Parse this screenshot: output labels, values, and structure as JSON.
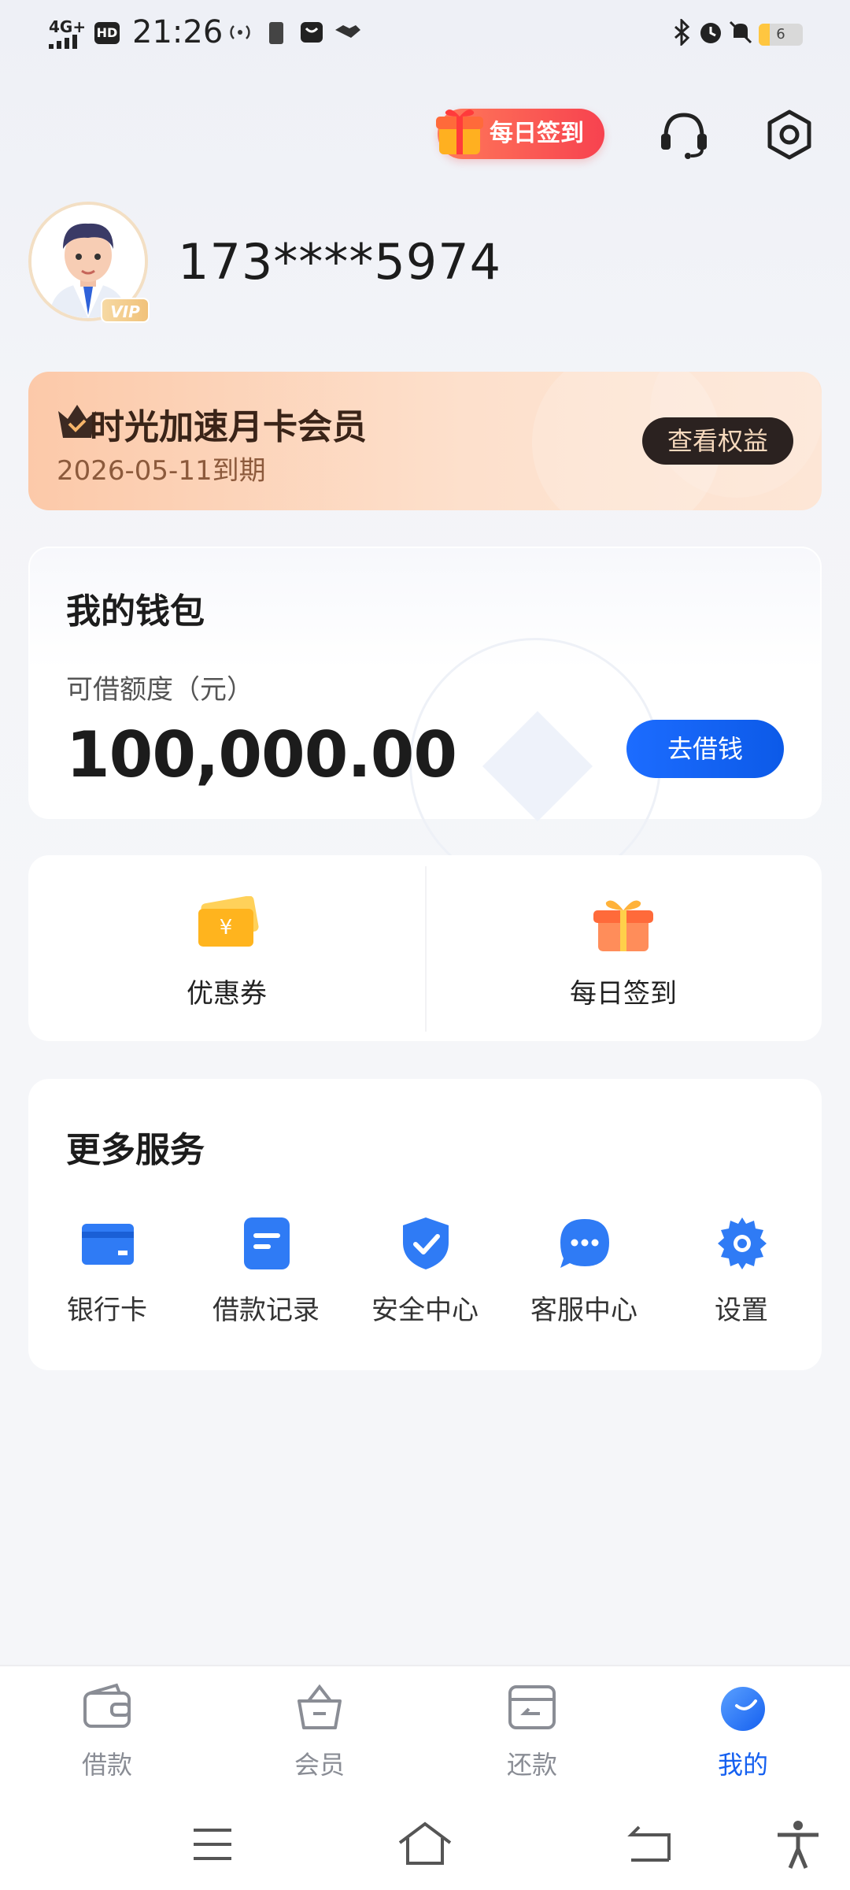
{
  "status_bar": {
    "network": "4G+",
    "hd": "HD",
    "time": "21:26",
    "battery": "6"
  },
  "header": {
    "daily_checkin_label": "每日签到"
  },
  "profile": {
    "vip_badge": "VIP",
    "phone": "173****5974"
  },
  "membership": {
    "title": "时光加速月卡会员",
    "expiry": "2026-05-11到期",
    "view_rights_label": "查看权益"
  },
  "wallet": {
    "title": "我的钱包",
    "limit_label": "可借额度（元）",
    "amount": "100,000.00",
    "borrow_label": "去借钱"
  },
  "quick_actions": [
    {
      "label": "优惠券",
      "icon": "coupon-icon"
    },
    {
      "label": "每日签到",
      "icon": "gift-icon"
    }
  ],
  "more_services": {
    "title": "更多服务",
    "items": [
      {
        "label": "银行卡",
        "icon": "bank-card-icon"
      },
      {
        "label": "借款记录",
        "icon": "document-icon"
      },
      {
        "label": "安全中心",
        "icon": "shield-check-icon"
      },
      {
        "label": "客服中心",
        "icon": "chat-bubble-icon"
      },
      {
        "label": "设置",
        "icon": "gear-icon"
      }
    ]
  },
  "bottom_nav": {
    "items": [
      {
        "label": "借款",
        "icon": "wallet-icon",
        "active": false
      },
      {
        "label": "会员",
        "icon": "member-basket-icon",
        "active": false
      },
      {
        "label": "还款",
        "icon": "repay-icon",
        "active": false
      },
      {
        "label": "我的",
        "icon": "profile-face-icon",
        "active": true
      }
    ]
  },
  "colors": {
    "accent_blue": "#1560f0",
    "member_gold": "#fcc9a9",
    "checkin_red": "#f7424f"
  }
}
